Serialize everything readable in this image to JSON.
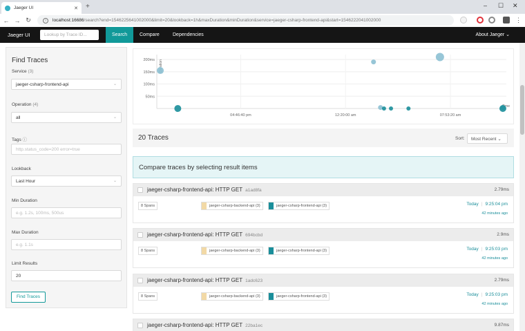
{
  "browser": {
    "tab_title": "Jaeger UI",
    "new_tab": "+",
    "url_host": "localhost:16686",
    "url_path": "/search?end=1546225641002000&limit=20&lookback=1h&maxDuration&minDuration&service=jaeger-csharp-frontend-api&start=1546222041002000"
  },
  "nav": {
    "brand": "Jaeger UI",
    "lookup_placeholder": "Lookup by Trace ID...",
    "items": [
      "Search",
      "Compare",
      "Dependencies"
    ],
    "about": "About Jaeger ⌄"
  },
  "find": {
    "title": "Find Traces",
    "service_label": "Service",
    "service_count": "(3)",
    "service_value": "jaeger-csharp-frontend-api",
    "operation_label": "Operation",
    "operation_count": "(4)",
    "operation_value": "all",
    "tags_label": "Tags",
    "tags_placeholder": "http.status_code=200 error=true",
    "lookback_label": "Lookback",
    "lookback_value": "Last Hour",
    "min_label": "Min Duration",
    "min_placeholder": "e.g. 1.2s, 100ms, 500us",
    "max_label": "Max Duration",
    "max_placeholder": "e.g. 1.1s",
    "limit_label": "Limit Results",
    "limit_value": "20",
    "button": "Find Traces"
  },
  "chart_data": {
    "type": "scatter",
    "ylabel": "Duration",
    "xlabel": "Time",
    "y_ticks": [
      "200ms",
      "150ms",
      "100ms",
      "50ms"
    ],
    "x_ticks": [
      "04:46:40 pm",
      "12:20:00 am",
      "07:53:20 am"
    ],
    "points": [
      {
        "x": 0.01,
        "y": 155,
        "size": 5,
        "color": "#8cc0d3"
      },
      {
        "x": 0.06,
        "y": 0,
        "size": 5,
        "color": "#1a8e9a"
      },
      {
        "x": 0.62,
        "y": 190,
        "size": 3.5,
        "color": "#8cc0d3"
      },
      {
        "x": 0.81,
        "y": 210,
        "size": 6,
        "color": "#8cc0d3"
      },
      {
        "x": 0.64,
        "y": 4,
        "size": 3.5,
        "color": "#8cc0d3"
      },
      {
        "x": 0.65,
        "y": 0,
        "size": 3,
        "color": "#1a8e9a"
      },
      {
        "x": 0.67,
        "y": 0,
        "size": 3,
        "color": "#1a8e9a"
      },
      {
        "x": 0.72,
        "y": 0,
        "size": 3,
        "color": "#1a8e9a"
      },
      {
        "x": 0.99,
        "y": 4,
        "size": 3.5,
        "color": "#8cc0d3"
      },
      {
        "x": 0.99,
        "y": 0,
        "size": 5,
        "color": "#1a8e9a"
      }
    ],
    "ylim": [
      0,
      220
    ],
    "grid": true
  },
  "results": {
    "count": "20 Traces",
    "sort_label": "Sort:",
    "sort_value": "Most Recent",
    "compare_msg": "Compare traces by selecting result items",
    "traces": [
      {
        "name": "jaeger-csharp-frontend-api: HTTP GET",
        "id": "a1ad8fa",
        "duration": "2.79ms",
        "spans": "8 Spans",
        "svc1": "jaeger-csharp-backend-api (3)",
        "svc2": "jaeger-csharp-frontend-api (3)",
        "day": "Today",
        "time": "9:25:04 pm",
        "ago": "42 minutes ago"
      },
      {
        "name": "jaeger-csharp-frontend-api: HTTP GET",
        "id": "694bcbd",
        "duration": "2.9ms",
        "spans": "8 Spans",
        "svc1": "jaeger-csharp-backend-api (3)",
        "svc2": "jaeger-csharp-frontend-api (3)",
        "day": "Today",
        "time": "9:25:03 pm",
        "ago": "42 minutes ago"
      },
      {
        "name": "jaeger-csharp-frontend-api: HTTP GET",
        "id": "1adc623",
        "duration": "2.79ms",
        "spans": "8 Spans",
        "svc1": "jaeger-csharp-backend-api (3)",
        "svc2": "jaeger-csharp-frontend-api (3)",
        "day": "Today",
        "time": "9:25:03 pm",
        "ago": "42 minutes ago"
      },
      {
        "name": "jaeger-csharp-frontend-api: HTTP GET",
        "id": "22ba1ec",
        "duration": "9.87ms"
      }
    ]
  },
  "colors": {
    "accent": "#119999",
    "backend": "#f2d9a6",
    "frontend": "#1a8e9a"
  }
}
